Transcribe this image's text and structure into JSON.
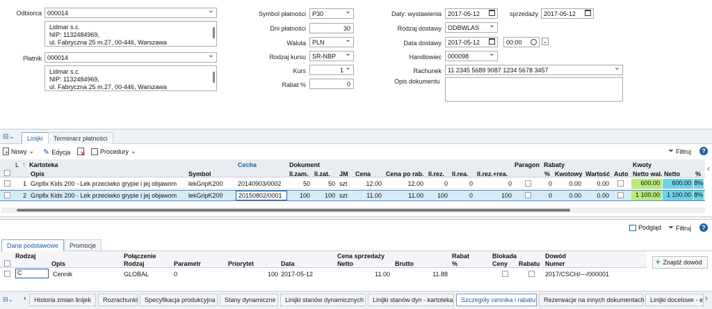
{
  "form": {
    "odbiorca_label": "Odbiorca",
    "odbiorca_value": "000014",
    "odbiorca_addr": [
      "Lidmar s.c.",
      "NIP: 1132484969,",
      "ul. Fabryczna 25 m.27, 00-446, Warszawa"
    ],
    "platnik_label": "Płatnik",
    "platnik_value": "000014",
    "platnik_addr": [
      "Lidmar s.c.",
      "NIP: 1132484969,",
      "ul. Fabryczna 25 m.27, 00-446, Warszawa"
    ],
    "symbol_label": "Symbol płatności",
    "symbol_value": "P30",
    "dni_label": "Dni płatności",
    "dni_value": "30",
    "waluta_label": "Waluta",
    "waluta_value": "PLN",
    "rodzaj_kursu_label": "Rodzaj kursu",
    "rodzaj_kursu_value": "SR-NBP",
    "kurs_label": "Kurs",
    "kurs_value": "1",
    "rabat_label": "Rabat %",
    "rabat_value": "0",
    "daty_label": "Daty: wystawienia",
    "daty_value": "2017-05-12",
    "sprzedazy_label": "sprzedaży",
    "sprzedazy_value": "2017-05-12",
    "rodzaj_dostawy_label": "Rodzaj dostawy",
    "rodzaj_dostawy_value": "ODBWLAS",
    "data_dostawy_label": "Data dostawy",
    "data_dostawy_value": "2017-05-12",
    "czas_value": "00:00",
    "handlowiec_label": "Handlowiec",
    "handlowiec_value": "000098",
    "rachunek_label": "Rachunek",
    "rachunek_value": "11 2345 5689 9087 1234 5678 3457",
    "opis_label": "Opis dokumentu",
    "opis_value": ""
  },
  "top_tabs": [
    "Linijki",
    "Terminarz płatności"
  ],
  "toolbar": {
    "nowy": "Nowy",
    "edycja": "Edycja",
    "procedury": "Procedury",
    "filtruj": "Filtruj",
    "help": "?"
  },
  "lines_header": {
    "l": "L",
    "kartoteka": "Kartoteka",
    "opis": "Opis",
    "symbol": "Symbol",
    "cecha": "Cecha",
    "dokument": "Dokument",
    "ilzam": "Il.zam.",
    "ilzat": "Il.zat.",
    "jm": "JM",
    "cena": "Cena",
    "cena_po_rab": "Cena po rab.",
    "ilrez": "Il.rez.",
    "ilrea": "Il.rea.",
    "ilrezrea": "Il.rez.+rea.",
    "paragon": "Paragon",
    "rabaty": "Rabaty",
    "pct": "%",
    "kwotowy": "Kwotowy",
    "wartosc": "Wartość",
    "auto": "Auto",
    "kwoty": "Kwoty",
    "netto_wal": "Netto wal.",
    "netto": "Netto",
    "pct2": "%"
  },
  "lines": [
    {
      "lp": "1",
      "opis": "Gripfix Kids 200 - Lek przeciwko grypie i jej objawom",
      "symbol": "lekGripK200",
      "cecha": "20140903/0002",
      "ilzam": "50",
      "ilzat": "50",
      "jm": "szt",
      "cena": "12.00",
      "cena_po_rab": "12.00",
      "ilrez": "0",
      "ilrea": "0",
      "ilrezrea": "0",
      "rabat_pct": "0",
      "kwotowy": "0.00",
      "wartosc": "0.00",
      "netto_wal": "600.00",
      "netto": "600.00",
      "vat": "8%"
    },
    {
      "lp": "2",
      "opis": "Gripfix Kids 200 - Lek przeciwko grypie i jej objawom",
      "symbol": "lekGripK200",
      "cecha": "20150802/0001",
      "ilzam": "100",
      "ilzat": "100",
      "jm": "szt",
      "cena": "11.00",
      "cena_po_rab": "11.00",
      "ilrez": "100",
      "ilrea": "0",
      "ilrezrea": "100",
      "rabat_pct": "0",
      "kwotowy": "0.00",
      "wartosc": "0.00",
      "netto_wal": "1 100.00",
      "netto": "1 100.00",
      "vat": "8%"
    }
  ],
  "lower_toolbar": {
    "podglad": "Podgląd",
    "filtruj": "Filtruj",
    "help": "?"
  },
  "lower_tabs": [
    "Dane podstawowe",
    "Promocje"
  ],
  "price_header": {
    "rodzaj": "Rodzaj",
    "polaczenie": "Połączenie",
    "opis": "Opis",
    "rodzaj2": "Rodzaj",
    "parametr": "Parametr",
    "priorytet": "Priorytet",
    "data": "Data",
    "cena_sprzedazy": "Cena sprzedaży",
    "netto": "Netto",
    "brutto": "Brutto",
    "rabat": "Rabat",
    "pct": "%",
    "blokada": "Blokada",
    "ceny": "Ceny",
    "rabatu": "Rabatu",
    "dowod": "Dowód",
    "numer": "Numer"
  },
  "price_row": {
    "rodzaj": "C",
    "opis": "Cennik",
    "rodzaj2": "GLOBAL",
    "parametr": "0",
    "priorytet": "100",
    "data": "2017-05-12",
    "netto": "11.00",
    "brutto": "11.88",
    "dowod": "2017/CSCH/---/000001"
  },
  "znajdz_label": "Znajdź dowód",
  "bottom_tabs": [
    "Historia zmian linijek",
    "Rozrachunki",
    "Specyfikacja produkcyjna",
    "Stany dynamiczne",
    "Linijki stanów dynamicznych",
    "Linijki stanów dyn - kartoteka",
    "Szczegóły cennika i rabatu",
    "Rezerwacje na innych dokumentach",
    "Linijki docelowe - e"
  ],
  "colors": {
    "accent": "#1d5da8",
    "green": "#b9ea7a",
    "teal": "#6fd3e6",
    "selected": "#d6ebf7"
  }
}
